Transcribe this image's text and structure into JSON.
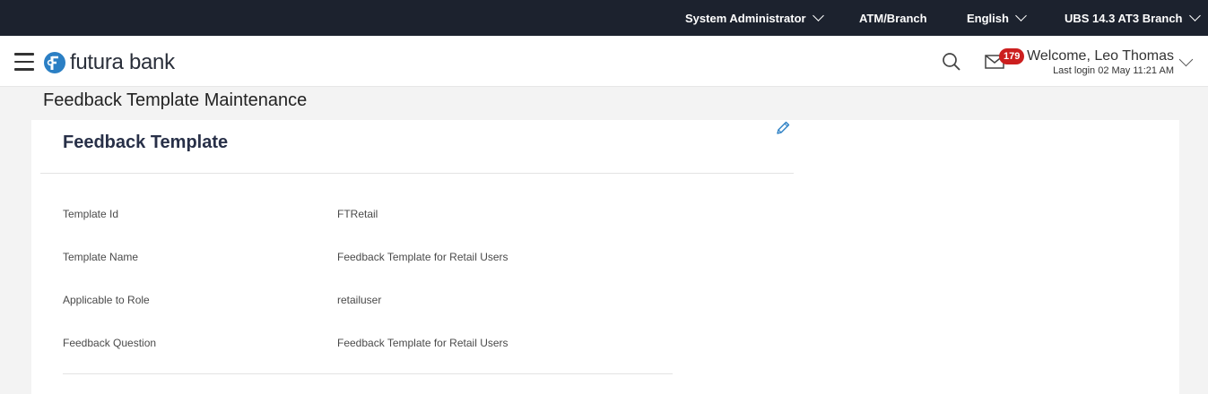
{
  "topbar": {
    "role": "System Administrator",
    "entity": "ATM/Branch",
    "language": "English",
    "branch": "UBS 14.3 AT3 Branch"
  },
  "header": {
    "brand": "futura bank",
    "notification_count": "179",
    "welcome": "Welcome, Leo Thomas",
    "last_login": "Last login 02 May 11:21 AM"
  },
  "page": {
    "title": "Feedback Template Maintenance"
  },
  "card": {
    "title": "Feedback Template",
    "rows": [
      {
        "label": "Template Id",
        "value": "FTRetail"
      },
      {
        "label": "Template Name",
        "value": "Feedback Template for Retail Users"
      },
      {
        "label": "Applicable to Role",
        "value": "retailuser"
      },
      {
        "label": "Feedback Question",
        "value": "Feedback Template for Retail Users"
      }
    ]
  },
  "icons": {
    "menu": "hamburger-menu-icon",
    "logo": "futura-bank-logo",
    "search": "search-icon",
    "mail": "mail-icon",
    "edit": "pencil-icon"
  },
  "colors": {
    "topbar_bg": "#1c222e",
    "badge_bg": "#cc1f1f",
    "brand_blue": "#2b7fc4",
    "title_color": "#283048"
  }
}
